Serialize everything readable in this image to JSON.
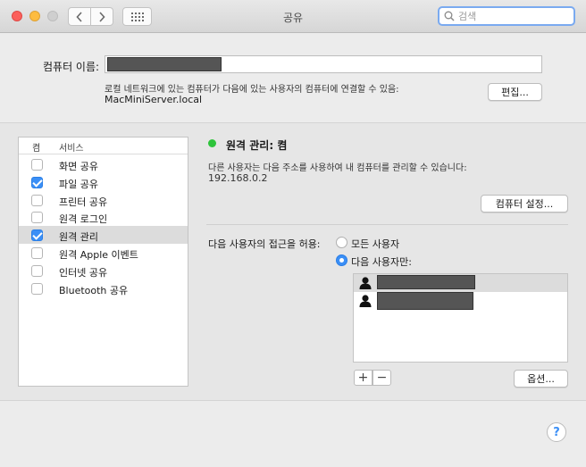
{
  "window": {
    "title": "공유"
  },
  "search": {
    "placeholder": "검색"
  },
  "computer_name": {
    "label": "컴퓨터 이름:",
    "description": "로컬 네트워크에 있는 컴퓨터가 다음에 있는 사용자의 컴퓨터에 연결할 수 있음:",
    "local_address": "MacMiniServer.local",
    "edit_label": "편집..."
  },
  "services": {
    "header_on": "켬",
    "header_service": "서비스",
    "items": [
      {
        "label": "화면 공유",
        "checked": false,
        "selected": false
      },
      {
        "label": "파일 공유",
        "checked": true,
        "selected": false
      },
      {
        "label": "프린터 공유",
        "checked": false,
        "selected": false
      },
      {
        "label": "원격 로그인",
        "checked": false,
        "selected": false
      },
      {
        "label": "원격 관리",
        "checked": true,
        "selected": true
      },
      {
        "label": "원격 Apple 이벤트",
        "checked": false,
        "selected": false
      },
      {
        "label": "인터넷 공유",
        "checked": false,
        "selected": false
      },
      {
        "label": "Bluetooth 공유",
        "checked": false,
        "selected": false
      }
    ]
  },
  "detail": {
    "status": "원격 관리: 켬",
    "status_color": "#2ec43b",
    "info": "다른 사용자는 다음 주소를 사용하여 내 컴퓨터를 관리할 수 있습니다:",
    "address": "192.168.0.2",
    "settings_label": "컴퓨터 설정...",
    "allow_label": "다음 사용자의 접근을 허용:",
    "option_all": "모든 사용자",
    "option_only": "다음 사용자만:",
    "selected_option": "only",
    "options_label": "옵션...",
    "plus_label": "+",
    "minus_label": "−"
  },
  "help": {
    "label": "?"
  },
  "colors": {
    "accent": "#3b8ff6"
  }
}
